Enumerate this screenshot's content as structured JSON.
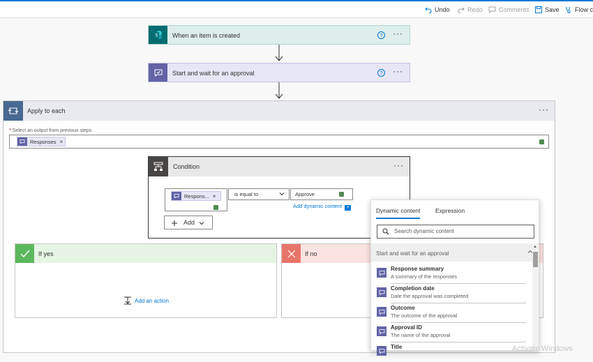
{
  "toolbar": {
    "undo": "Undo",
    "redo": "Redo",
    "comments": "Comments",
    "save": "Save",
    "flow_checker": "Flow c"
  },
  "steps": {
    "trigger_title": "When an item is created",
    "approval_title": "Start and wait for an approval",
    "help_glyph": "?"
  },
  "apply_to_each": {
    "title": "Apply to each",
    "select_label_required": "*",
    "select_label": "Select an output from previous steps",
    "token_label": "Responses"
  },
  "condition": {
    "title": "Condition",
    "left_token": "Respons...",
    "operator": "is equal to",
    "right_value": "Approve",
    "add_dynamic": "Add dynamic content",
    "add_button": "Add"
  },
  "branches": {
    "yes_title": "If yes",
    "no_title": "If no",
    "add_action": "Add an action"
  },
  "dynamic_panel": {
    "tabs": [
      "Dynamic content",
      "Expression"
    ],
    "search_placeholder": "Search dynamic content",
    "group": "Start and wait for an approval",
    "items": [
      {
        "name": "Response summary",
        "desc": "A summary of the responses"
      },
      {
        "name": "Completion date",
        "desc": "Date the approval was completed"
      },
      {
        "name": "Outcome",
        "desc": "The outcome of the approval"
      },
      {
        "name": "Approval ID",
        "desc": "The name of the approval"
      },
      {
        "name": "Title",
        "desc": ""
      }
    ]
  },
  "watermark": "Activate Windows",
  "colors": {
    "accent": "#0078d4",
    "approval": "#6264a7",
    "sharepoint": "#036c70",
    "loop": "#486991",
    "yes": "#5cb85c",
    "no": "#e8756a"
  }
}
